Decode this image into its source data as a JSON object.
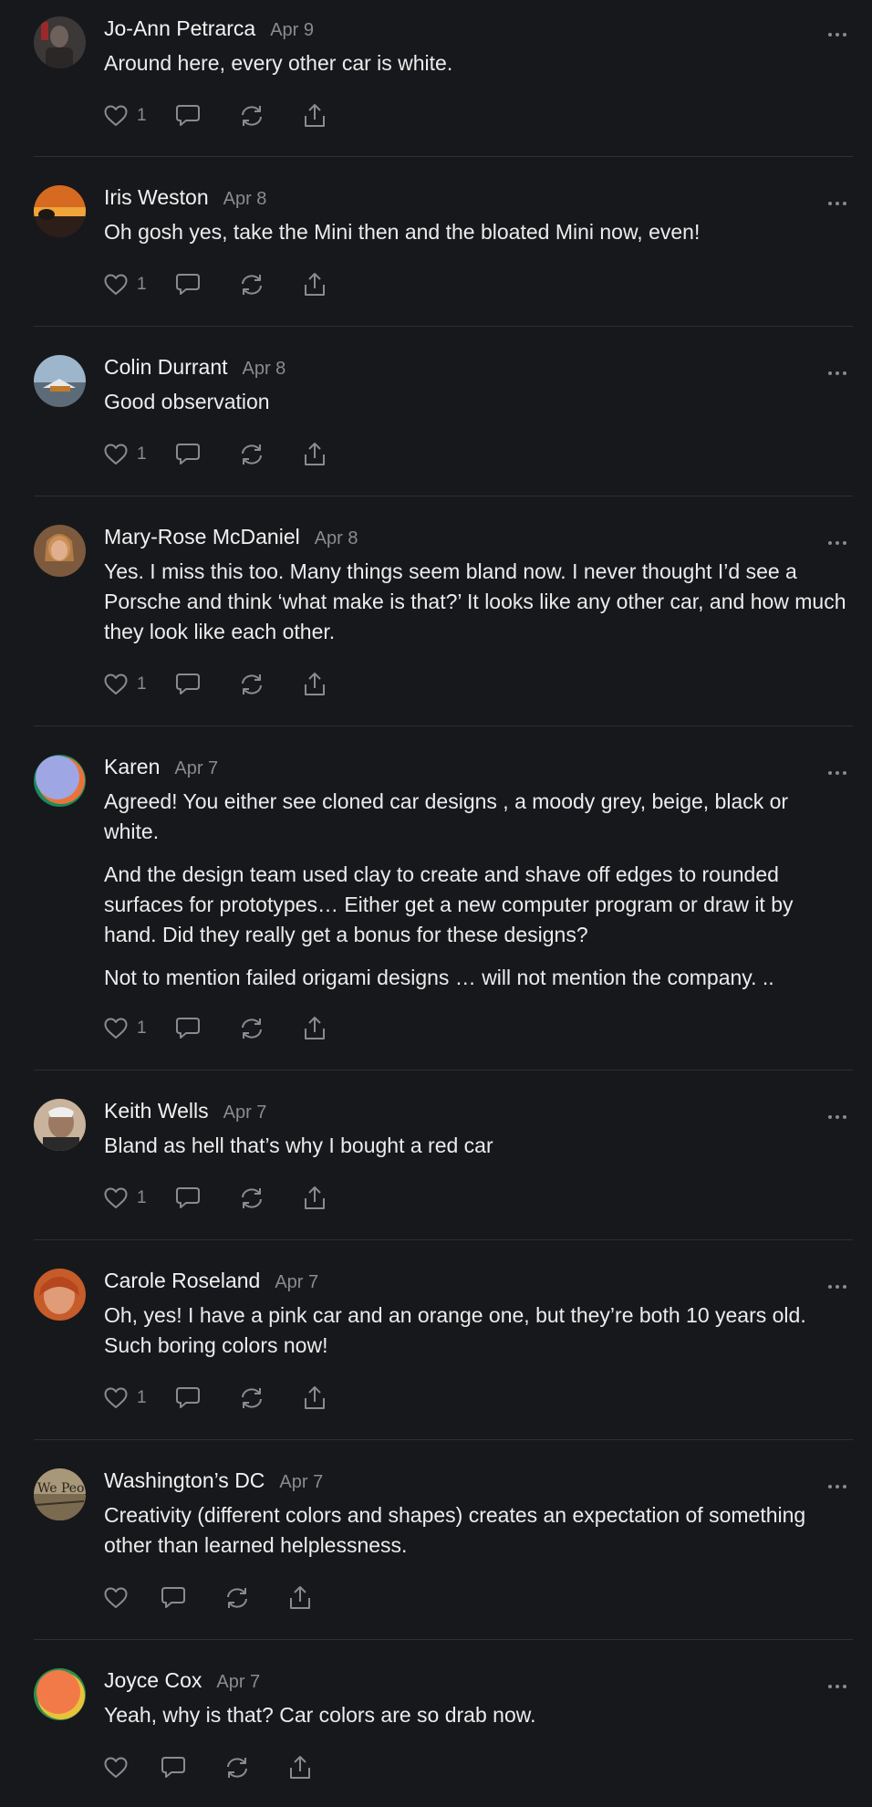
{
  "comments": [
    {
      "author": "Jo-Ann Petrarca",
      "date": "Apr 9",
      "paragraphs": [
        "Around here, every other car is white."
      ],
      "likes": "1",
      "avatar_color": "#5d5a57"
    },
    {
      "author": "Iris Weston",
      "date": "Apr 8",
      "paragraphs": [
        "Oh gosh yes, take the Mini then and the bloated Mini now, even!"
      ],
      "likes": "1",
      "avatar_color": "#c7561e"
    },
    {
      "author": "Colin Durrant",
      "date": "Apr 8",
      "paragraphs": [
        "Good observation"
      ],
      "likes": "1",
      "avatar_color": "#8ea3b6"
    },
    {
      "author": "Mary-Rose McDaniel",
      "date": "Apr 8",
      "paragraphs": [
        "Yes. I miss this too. Many things seem bland now. I never thought I’d see a Porsche and think ‘what make is that?’ It looks like any other car, and how much they look like each other."
      ],
      "likes": "1",
      "avatar_color": "#a9744f"
    },
    {
      "author": "Karen",
      "date": "Apr 7",
      "paragraphs": [
        "Agreed! You either see cloned car designs , a moody grey, beige, black or white.",
        "And the design team used clay to create and shave off edges to rounded surfaces for prototypes… Either get a new computer program or draw it by hand. Did they really get a bonus for these designs?",
        "Not to mention failed origami designs … will not mention the company. .."
      ],
      "likes": "1",
      "avatar_color": "#9fa6e4"
    },
    {
      "author": "Keith Wells",
      "date": "Apr 7",
      "paragraphs": [
        "Bland as hell that’s why I bought a red car"
      ],
      "likes": "1",
      "avatar_color": "#b89a82"
    },
    {
      "author": "Carole Roseland",
      "date": "Apr 7",
      "paragraphs": [
        "Oh, yes! I have a pink car and an orange one, but they’re both 10 years old. Such boring colors now!"
      ],
      "likes": "1",
      "avatar_color": "#b7592e"
    },
    {
      "author": "Washington’s DC",
      "date": "Apr 7",
      "paragraphs": [
        "Creativity (different colors and shapes) creates an expectation of something other than learned helplessness."
      ],
      "likes": "",
      "avatar_color": "#9a8a6e"
    },
    {
      "author": "Joyce Cox",
      "date": "Apr 7",
      "paragraphs": [
        "Yeah, why is that? Car colors are so drab now."
      ],
      "likes": "",
      "avatar_color": "#f27a49"
    }
  ],
  "colors": {
    "background": "#17181b",
    "divider": "#2e2f33",
    "author_text": "#f2f2f2",
    "secondary_text": "#8a8b90",
    "icon": "#8a8b90"
  },
  "icons": {
    "like": "heart-icon",
    "comment": "speech-bubble-icon",
    "restack": "restack-icon",
    "share": "share-icon",
    "more": "more-options-icon"
  }
}
